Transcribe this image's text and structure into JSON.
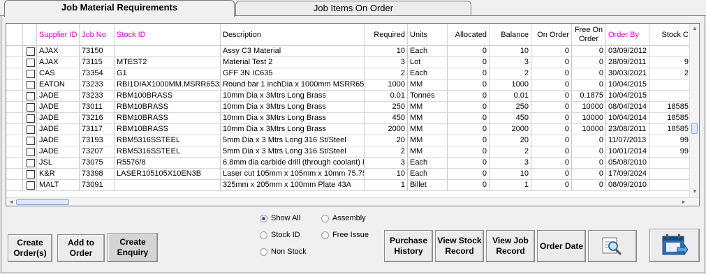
{
  "tabs": {
    "active": "Job Material Requirements",
    "inactive": "Job Items On Order"
  },
  "columns": [
    "Supplier ID",
    "Job No",
    "Stock ID",
    "Description",
    "Required",
    "Units",
    "Allocated",
    "Balance",
    "On Order",
    "Free On Order",
    "Order By",
    "Stock C"
  ],
  "rows": [
    [
      "AJAX",
      "73150",
      "",
      "Assy C3 Material",
      "10",
      "Each",
      "0",
      "10",
      "0",
      "0",
      "03/09/2012",
      ""
    ],
    [
      "AJAX",
      "73115",
      "MTEST2",
      "Material Test 2",
      "3",
      "Lot",
      "0",
      "3",
      "0",
      "0",
      "28/09/2011",
      "9"
    ],
    [
      "CAS",
      "73354",
      "G1",
      "GFF 3N IC635",
      "2",
      "Each",
      "0",
      "2",
      "0",
      "0",
      "30/03/2021",
      "2"
    ],
    [
      "EATON",
      "73233",
      "RBI1DIAX1000MM.MSRR6532",
      "Round bar 1 inchDia x 1000mm MSRR6532",
      "1000",
      "MM",
      "0",
      "1000",
      "0",
      "0",
      "10/04/2015",
      ""
    ],
    [
      "JADE",
      "73233",
      "RBM100BRASS",
      "10mm Dia x 3Mtrs Long Brass",
      "0.01",
      "Tonnes",
      "0",
      "0.01",
      "0",
      "0.1875",
      "10/04/2015",
      ""
    ],
    [
      "JADE",
      "73011",
      "RBM10BRASS",
      "10mm Dia x 3Mtrs Long Brass",
      "250",
      "MM",
      "0",
      "250",
      "0",
      "10000",
      "08/04/2014",
      "18585"
    ],
    [
      "JADE",
      "73216",
      "RBM10BRASS",
      "10mm Dia x 3Mtrs Long Brass",
      "450",
      "MM",
      "0",
      "450",
      "0",
      "10000",
      "10/04/2014",
      "18585"
    ],
    [
      "JADE",
      "73117",
      "RBM10BRASS",
      "10mm Dia x 3Mtrs Long Brass",
      "2000",
      "MM",
      "0",
      "2000",
      "0",
      "10000",
      "23/08/2011",
      "18585"
    ],
    [
      "JADE",
      "73193",
      "RBM5316SSTEEL",
      "5mm Dia x 3 Mtrs Long 316 St/Steel",
      "20",
      "MM",
      "0",
      "20",
      "0",
      "0",
      "11/07/2013",
      "99"
    ],
    [
      "JADE",
      "73207",
      "RBM5316SSTEEL",
      "5mm Dia x 3 Mtrs Long 316 St/Steel",
      "2",
      "MM",
      "0",
      "2",
      "0",
      "0",
      "10/01/2014",
      "99"
    ],
    [
      "JSL",
      "73075",
      "R5576/8",
      "6.8mm dia carbide drill (through coolant) R",
      "3",
      "Each",
      "0",
      "3",
      "0",
      "0",
      "05/08/2010",
      ""
    ],
    [
      "K&R",
      "73398",
      "LASER105105X10EN3B",
      "Laser cut 105mm x 105mm x 10mm 75.75r",
      "10",
      "Each",
      "0",
      "10",
      "0",
      "0",
      "17/09/2024",
      ""
    ],
    [
      "MALT",
      "73091",
      "",
      "325mm x 205mm x 100mm Plate 43A",
      "1",
      "Billet",
      "0",
      "1",
      "0",
      "0",
      "08/09/2010",
      ""
    ]
  ],
  "radios": {
    "show_all": "Show All",
    "assembly": "Assembly",
    "stock_id": "Stock ID",
    "free_issue": "Free Issue",
    "non_stock": "Non Stock",
    "selected": "Show All"
  },
  "buttons": {
    "create_orders": "Create Order(s)",
    "add_to_order": "Add to Order",
    "create_enquiry": "Create Enquiry",
    "purchase_history": "Purchase History",
    "view_stock_record": "View Stock Record",
    "view_job_record": "View Job Record",
    "order_date": "Order Date"
  },
  "icons": {
    "search": "magnifier-icon",
    "exit": "calendar-exit-icon"
  }
}
